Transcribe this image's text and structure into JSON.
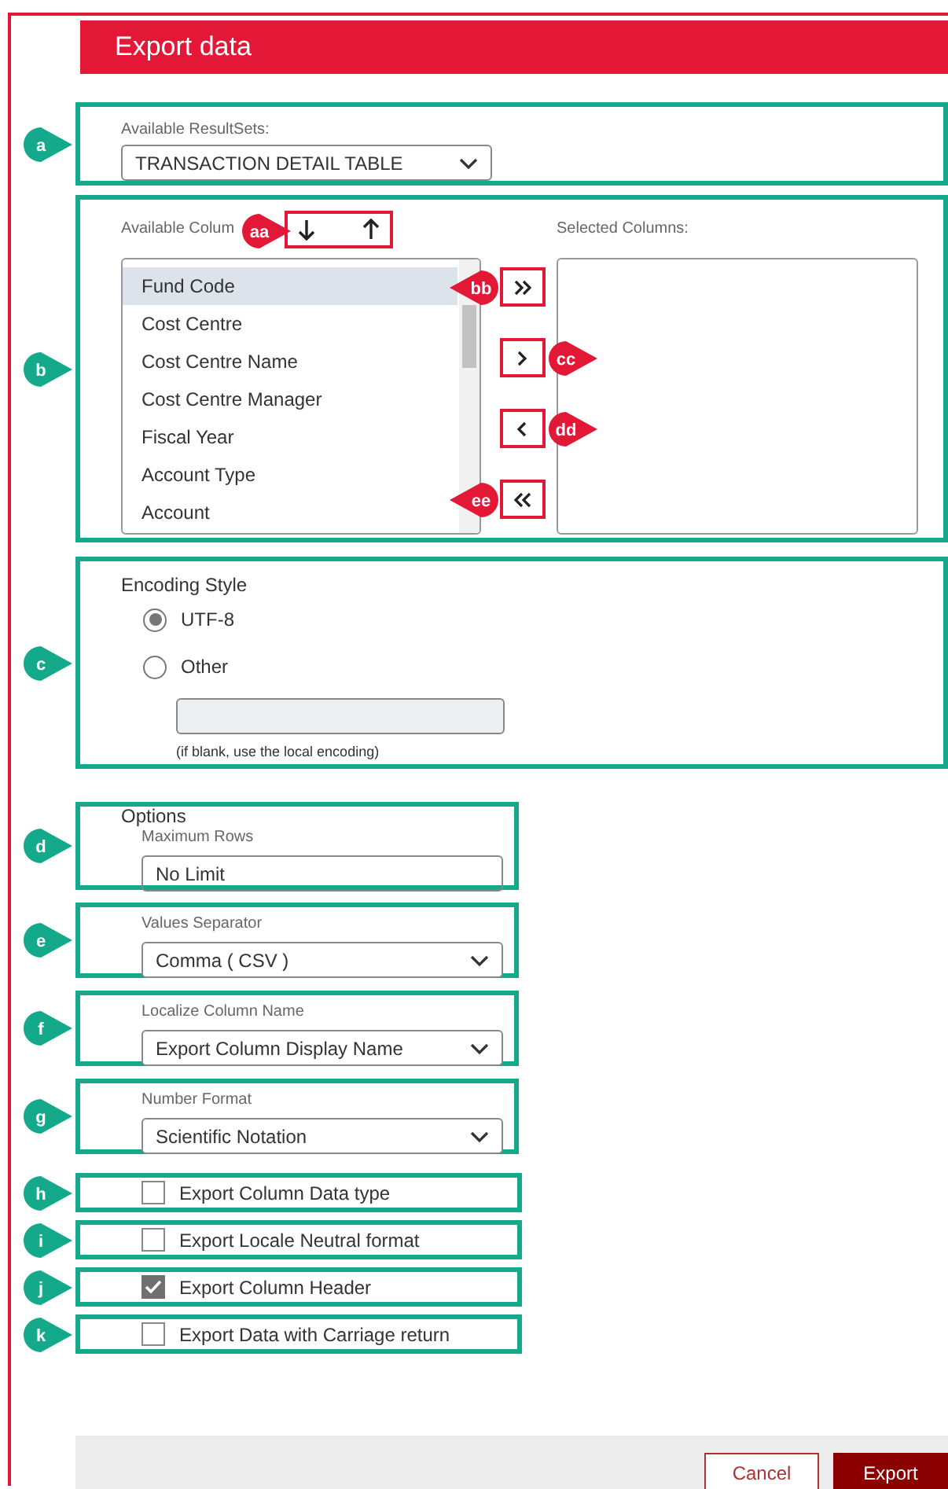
{
  "dialog": {
    "title": "Export data"
  },
  "result_sets": {
    "callout": "a",
    "label": "Available ResultSets:",
    "value": "TRANSACTION DETAIL TABLE"
  },
  "columns": {
    "callout": "b",
    "available_label": "Available Colum",
    "selected_label": "Selected Columns:",
    "sort_callout": "aa",
    "sort_buttons": [
      {
        "kind": "down"
      },
      {
        "kind": "up"
      }
    ],
    "available": [
      {
        "label": "Fund Code",
        "selected": true
      },
      {
        "label": "Cost Centre",
        "selected": false
      },
      {
        "label": "Cost Centre Name",
        "selected": false
      },
      {
        "label": "Cost Centre Manager",
        "selected": false
      },
      {
        "label": "Fiscal Year",
        "selected": false
      },
      {
        "label": "Account Type",
        "selected": false
      },
      {
        "label": "Account",
        "selected": false
      }
    ],
    "move_buttons": [
      {
        "kind": "add-all",
        "callout": "bb"
      },
      {
        "kind": "add",
        "callout": "cc"
      },
      {
        "kind": "remove",
        "callout": "dd"
      },
      {
        "kind": "remove-all",
        "callout": "ee"
      }
    ]
  },
  "encoding": {
    "callout": "c",
    "title": "Encoding Style",
    "options": [
      {
        "label": "UTF-8",
        "selected": true
      },
      {
        "label": "Other",
        "selected": false
      }
    ],
    "custom_encoding": {
      "disabled": true
    },
    "hint": "(if blank, use the local encoding)"
  },
  "options": {
    "title": "Options",
    "fields": [
      {
        "kind": "text",
        "callout": "d",
        "label": "Maximum Rows",
        "value": "No Limit"
      },
      {
        "kind": "select",
        "callout": "e",
        "label": "Values Separator",
        "value": "Comma ( CSV )"
      },
      {
        "kind": "select",
        "callout": "f",
        "label": "Localize Column Name",
        "value": "Export Column Display Name"
      },
      {
        "kind": "select",
        "callout": "g",
        "label": "Number Format",
        "value": "Scientific Notation"
      }
    ],
    "checkboxes": [
      {
        "callout": "h",
        "label": "Export Column Data type",
        "checked": false
      },
      {
        "callout": "i",
        "label": "Export Locale Neutral format",
        "checked": false
      },
      {
        "callout": "j",
        "label": "Export Column Header",
        "checked": true
      },
      {
        "callout": "k",
        "label": "Export Data with Carriage return",
        "checked": false
      }
    ]
  },
  "buttons": [
    {
      "kind": "secondary",
      "label": "Cancel"
    },
    {
      "kind": "primary",
      "label": "Export"
    }
  ]
}
